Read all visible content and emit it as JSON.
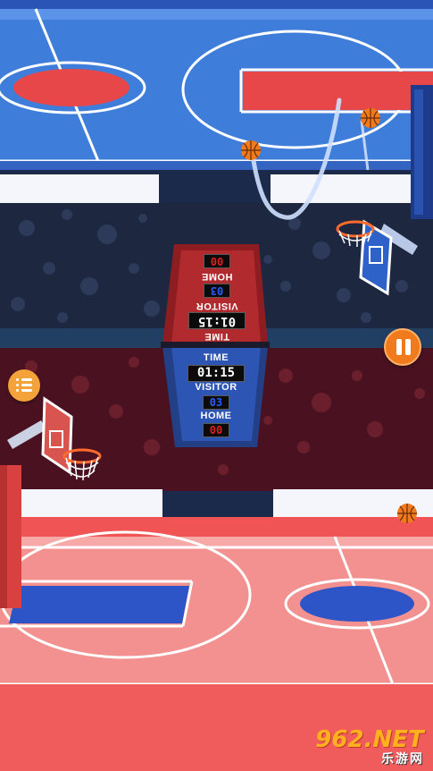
{
  "scoreboard": {
    "flipped": {
      "home_label": "HOME",
      "home_score": "00",
      "visitor_label": "VISITOR",
      "visitor_score": "03",
      "time_label": "TIME",
      "time_value": "01:15"
    },
    "upright": {
      "time_label": "TIME",
      "time_value": "01:15",
      "visitor_label": "VISITOR",
      "visitor_score": "03",
      "home_label": "HOME",
      "home_score": "00"
    }
  },
  "buttons": {
    "pause_icon": "pause-icon",
    "menu_icon": "menu-icon"
  },
  "watermark": {
    "logo_text": "962.NET",
    "sub_text": "乐游网"
  },
  "colors": {
    "top_court": "#3b73d6",
    "bottom_court": "#f08a8a",
    "accent_orange": "#f07a1c",
    "score_red": "#e02020",
    "score_blue": "#2a5cff"
  }
}
